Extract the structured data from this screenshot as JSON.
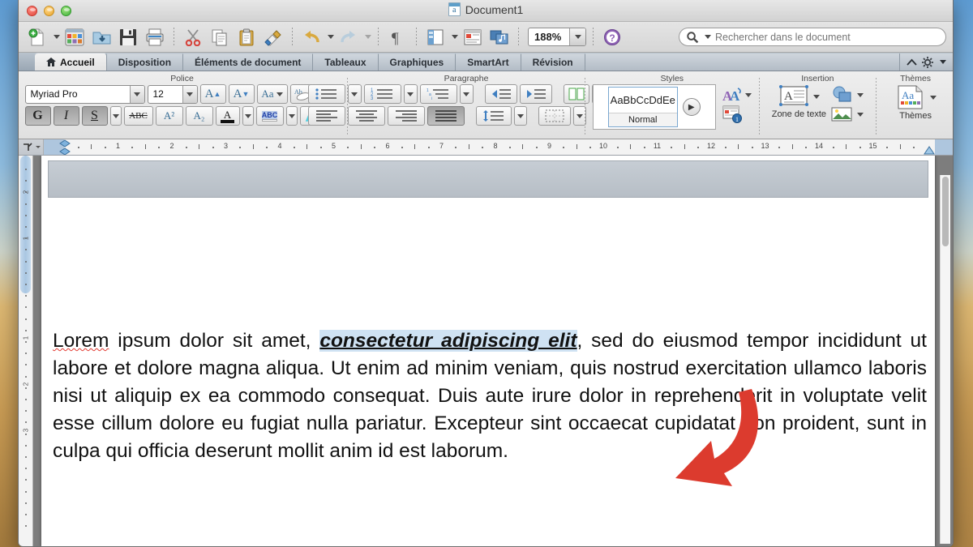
{
  "window": {
    "title": "Document1",
    "traffic_lights": [
      "close",
      "minimize",
      "maximize"
    ]
  },
  "toolbar": {
    "items": [
      {
        "name": "new-document",
        "label": "Nouveau"
      },
      {
        "name": "open-gallery",
        "label": "Galerie"
      },
      {
        "name": "open-file",
        "label": "Ouvrir"
      },
      {
        "name": "save",
        "label": "Enregistrer"
      },
      {
        "name": "print",
        "label": "Imprimer"
      },
      {
        "name": "cut",
        "label": "Couper"
      },
      {
        "name": "copy",
        "label": "Copier"
      },
      {
        "name": "paste",
        "label": "Coller"
      },
      {
        "name": "format-painter",
        "label": "Reproduire la mise en forme"
      },
      {
        "name": "undo",
        "label": "Annuler"
      },
      {
        "name": "redo",
        "label": "Rétablir"
      },
      {
        "name": "show-marks",
        "label": "Afficher tout"
      },
      {
        "name": "sidebar-toggle",
        "label": "Volet"
      },
      {
        "name": "notebook-view",
        "label": "Affichage"
      },
      {
        "name": "media-browser",
        "label": "Navigateur multimédia"
      },
      {
        "name": "help",
        "label": "Aide"
      }
    ],
    "zoom_value": "188%",
    "search_placeholder": "Rechercher dans le document",
    "search_value": ""
  },
  "tabs": [
    {
      "label": "Accueil",
      "active": true,
      "icon": "home-icon"
    },
    {
      "label": "Disposition",
      "active": false
    },
    {
      "label": "Éléments de document",
      "active": false
    },
    {
      "label": "Tableaux",
      "active": false
    },
    {
      "label": "Graphiques",
      "active": false
    },
    {
      "label": "SmartArt",
      "active": false
    },
    {
      "label": "Révision",
      "active": false
    }
  ],
  "ribbon": {
    "groups": [
      {
        "title": "Police"
      },
      {
        "title": "Paragraphe"
      },
      {
        "title": "Styles"
      },
      {
        "title": "Insertion"
      },
      {
        "title": "Thèmes"
      }
    ],
    "font": {
      "family": "Myriad Pro",
      "size": "12",
      "bold_label": "G",
      "italic_label": "I",
      "underline_label": "S",
      "strikethrough_label": "ABC",
      "superscript_label": "A²",
      "subscript_label": "A₂",
      "highlight_label": "ABC",
      "grow_label": "A",
      "shrink_label": "A",
      "case_label": "Aa",
      "clear_label": "Ab"
    },
    "styles": {
      "preview_text": "AaBbCcDdEe",
      "style_name": "Normal"
    },
    "insertion": {
      "text_box_label": "Zone de texte"
    },
    "themes": {
      "themes_label": "Thèmes",
      "themes_icon_label": "Aa"
    }
  },
  "ruler": {
    "horizontal_numbers": [
      "1",
      "2",
      "3",
      "4",
      "5",
      "6",
      "7",
      "8",
      "9",
      "10",
      "11",
      "12",
      "13",
      "14",
      "15"
    ],
    "vertical_margin_numbers": [
      "2",
      "1"
    ],
    "vertical_page_numbers": [
      "1",
      "2",
      "3"
    ]
  },
  "document": {
    "paragraph_parts": [
      {
        "text": "Lorem",
        "style": "misspelled"
      },
      {
        "text": " ipsum dolor sit amet, ",
        "style": "plain"
      },
      {
        "text": "consectetur adipiscing elit",
        "style": "selected-bold-italic-underline"
      },
      {
        "text": ", sed do eiusmod tempor incididunt ut labore et dolore magna aliqua. Ut enim ad minim veniam, quis nostrud exercitation ullamco laboris nisi ut aliquip ex ea commodo consequat. Duis aute irure dolor in reprehenderit in voluptate velit esse cillum dolore eu fugiat nulla pariatur. Excepteur sint occaecat cupidatat non proident, sunt in culpa qui officia deserunt mollit anim id est laborum.",
        "style": "plain"
      }
    ],
    "selection_text": "consectetur adipiscing elit",
    "alignment": "justify"
  },
  "annotation": {
    "arrow_color": "#dc3b2e",
    "arrow_target": "consectetur adipiscing elit"
  },
  "colors": {
    "selection_highlight": "#cfe2f3",
    "spellcheck_underline": "#e23b32",
    "ribbon_bg": "#e6e6e6",
    "tab_active": "#f2f2f2"
  }
}
